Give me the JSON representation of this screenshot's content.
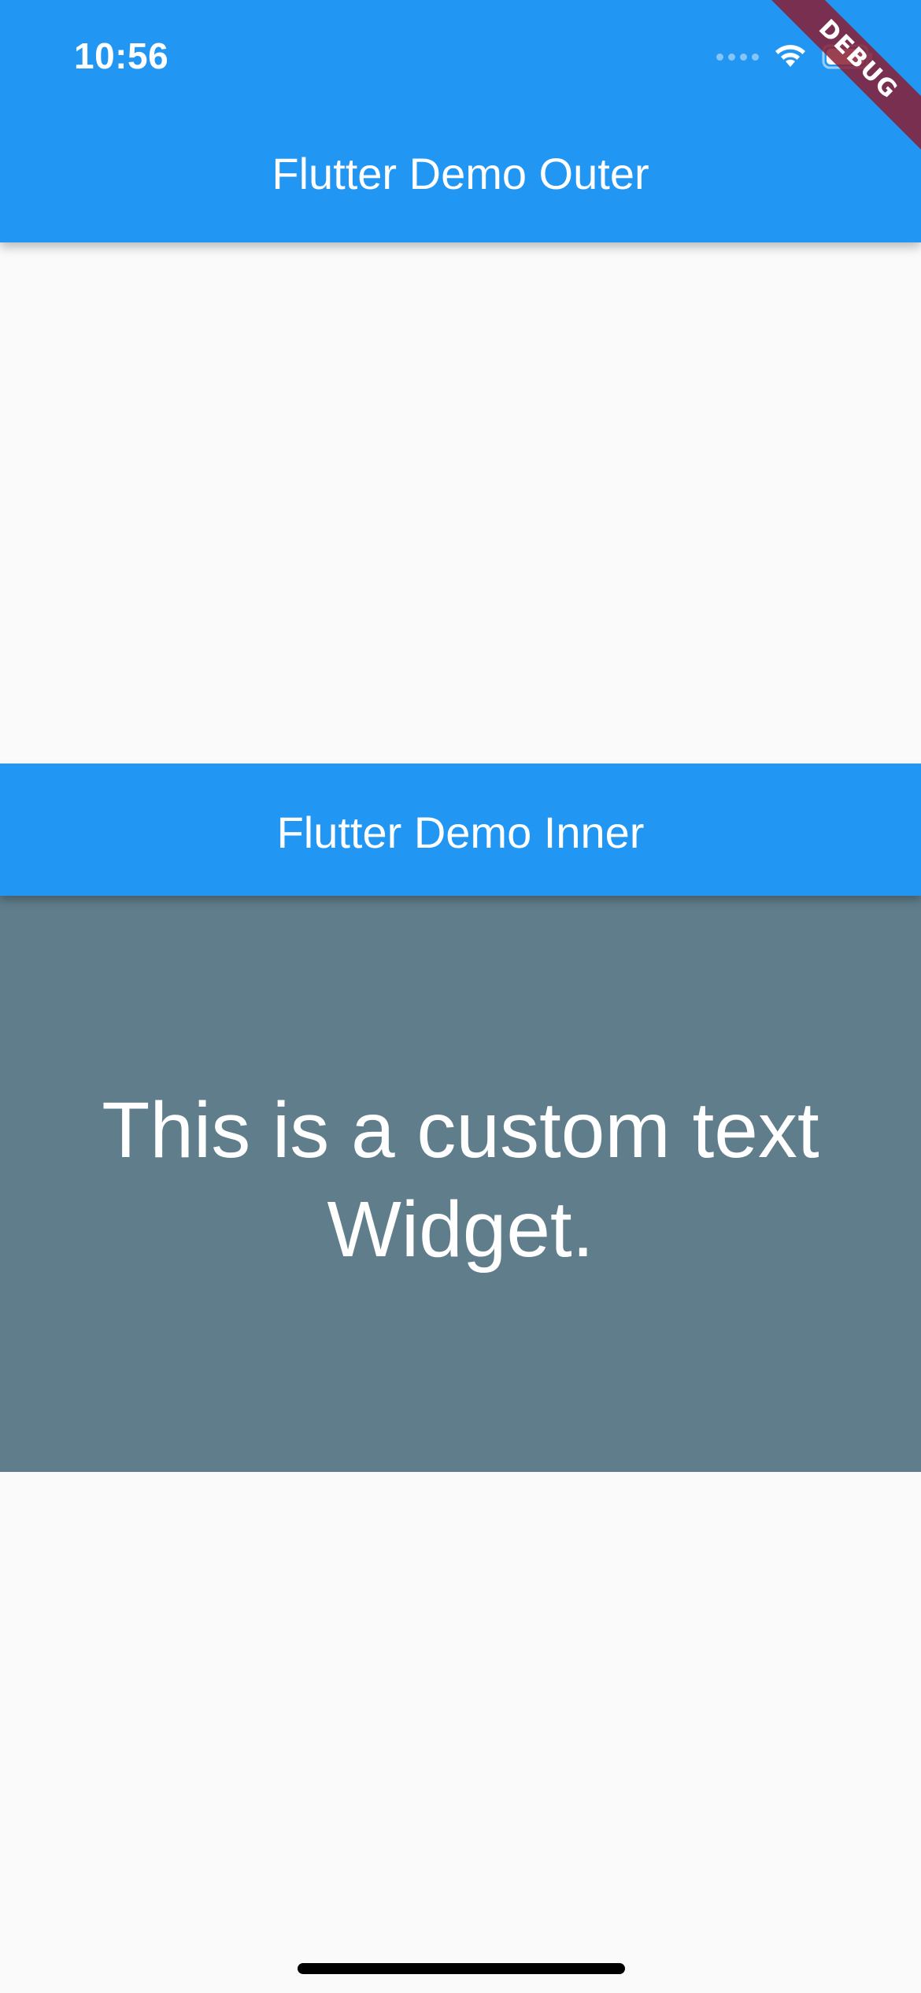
{
  "status_bar": {
    "time": "10:56",
    "icons": [
      "signal-dots-icon",
      "wifi-icon",
      "battery-icon"
    ]
  },
  "debug_banner": {
    "label": "DEBUG"
  },
  "outer_app_bar": {
    "title": "Flutter Demo Outer",
    "color": "#2196f3"
  },
  "inner_app_bar": {
    "title": "Flutter Demo Inner",
    "color": "#2196f3"
  },
  "custom_widget": {
    "text": "This is a custom text Widget.",
    "background": "#607d8b"
  },
  "colors": {
    "page_background": "#fafafa",
    "text_on_primary": "#ffffff",
    "debug_ribbon": "#881e32"
  }
}
